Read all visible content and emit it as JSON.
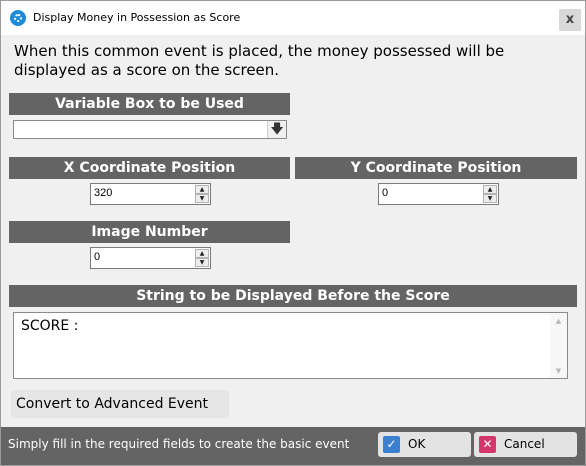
{
  "window": {
    "title": "Display Money in Possession as Score",
    "close_glyph": "x"
  },
  "description": "When this common event is placed, the money possessed will be displayed as a score on the screen.",
  "variable_box": {
    "header": "Variable Box to be Used",
    "value": "",
    "dropdown_icon": "arrow-down-icon"
  },
  "x_coord": {
    "header": "X Coordinate Position",
    "value": "320"
  },
  "y_coord": {
    "header": "Y Coordinate Position",
    "value": "0"
  },
  "image_number": {
    "header": "Image Number",
    "value": "0"
  },
  "prefix_string": {
    "header": "String to be Displayed Before the Score",
    "value": "SCORE :"
  },
  "advanced_button": {
    "label": "Convert to Advanced Event"
  },
  "footer": {
    "hint": "Simply fill in the required fields to create the basic event",
    "ok_label": "OK",
    "cancel_label": "Cancel"
  },
  "colors": {
    "section_header_bg": "#646464",
    "ok_icon": "#3b7fd0",
    "cancel_icon": "#d4356c"
  }
}
